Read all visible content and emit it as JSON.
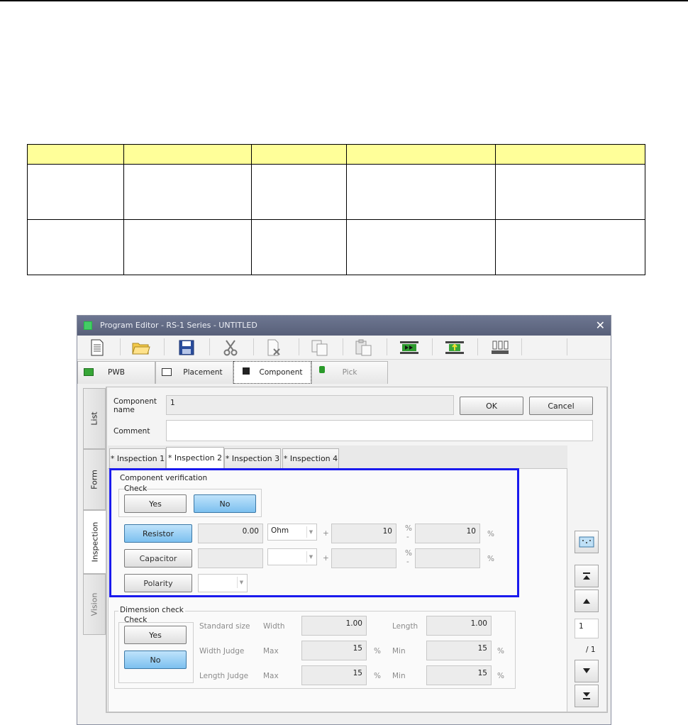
{
  "window": {
    "title": "Program Editor - RS-1 Series - UNTITLED"
  },
  "toolbar": {
    "icons": [
      "new-document-icon",
      "open-folder-icon",
      "save-icon",
      "cut-icon",
      "delete-icon",
      "copy-icon",
      "paste-icon",
      "pcb-transfer-icon",
      "board-icon",
      "nozzle-icon"
    ]
  },
  "mode_tabs": [
    {
      "label": "PWB",
      "icon": "pwb-icon"
    },
    {
      "label": "Placement",
      "icon": "placement-icon"
    },
    {
      "label": "Component",
      "icon": "chip-icon"
    },
    {
      "label": "Pick",
      "icon": "pick-icon"
    }
  ],
  "side_tabs": [
    "List",
    "Form",
    "Inspection",
    "Vision"
  ],
  "component": {
    "name_label": "Component name",
    "name_value": "1",
    "comment_label": "Comment",
    "comment_value": "",
    "ok_label": "OK",
    "cancel_label": "Cancel"
  },
  "inspection_tabs": [
    "* Inspection 1",
    "* Inspection 2",
    "* Inspection 3",
    "* Inspection 4"
  ],
  "verification": {
    "title": "Component verification",
    "check_label": "Check",
    "yes_label": "Yes",
    "no_label": "No",
    "resistor_label": "Resistor",
    "resistor_value": "0.00",
    "resistor_unit": "Ohm",
    "resistor_plus": "10",
    "resistor_minus": "10",
    "capacitor_label": "Capacitor",
    "polarity_label": "Polarity",
    "plus_sign": "+",
    "minus_sign": "-",
    "percent": "%"
  },
  "dimension": {
    "title": "Dimension check",
    "check_label": "Check",
    "yes_label": "Yes",
    "no_label": "No",
    "standard_size_label": "Standard size",
    "width_label": "Width",
    "width_value": "1.00",
    "length_label": "Length",
    "length_value": "1.00",
    "width_judge_label": "Width Judge",
    "length_judge_label": "Length Judge",
    "max_label": "Max",
    "min_label": "Min",
    "width_max": "15",
    "width_min": "15",
    "length_max": "15",
    "length_min": "15",
    "percent": "%"
  },
  "navigator": {
    "page_value": "1",
    "page_total": "/ 1"
  }
}
